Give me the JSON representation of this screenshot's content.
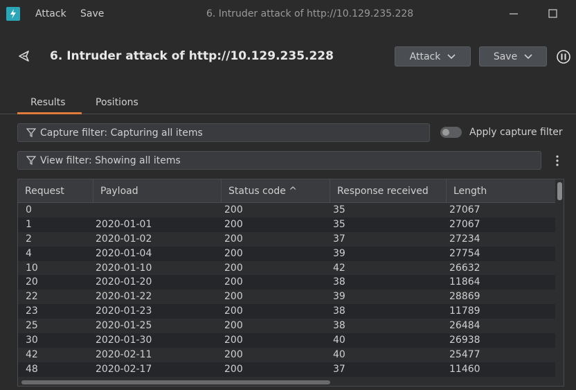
{
  "titlebar": {
    "menu": [
      "Attack",
      "Save"
    ],
    "window_title": "6. Intruder attack of http://10.129.235.228"
  },
  "header": {
    "title": "6. Intruder attack of http://10.129.235.228",
    "attack_label": "Attack",
    "save_label": "Save"
  },
  "tabs": [
    "Results",
    "Positions"
  ],
  "filters": {
    "capture": "Capture filter: Capturing all items",
    "view": "View filter: Showing all items",
    "apply_label": "Apply capture filter"
  },
  "table": {
    "columns": [
      "Request",
      "Payload",
      "Status code ^",
      "Response received",
      "Length"
    ],
    "rows": [
      [
        "0",
        "",
        "200",
        "35",
        "27067"
      ],
      [
        "1",
        "2020-01-01",
        "200",
        "35",
        "27067"
      ],
      [
        "2",
        "2020-01-02",
        "200",
        "37",
        "27234"
      ],
      [
        "4",
        "2020-01-04",
        "200",
        "39",
        "27754"
      ],
      [
        "10",
        "2020-01-10",
        "200",
        "42",
        "26632"
      ],
      [
        "20",
        "2020-01-20",
        "200",
        "38",
        "11864"
      ],
      [
        "22",
        "2020-01-22",
        "200",
        "39",
        "28869"
      ],
      [
        "23",
        "2020-01-23",
        "200",
        "38",
        "11789"
      ],
      [
        "25",
        "2020-01-25",
        "200",
        "38",
        "26484"
      ],
      [
        "30",
        "2020-01-30",
        "200",
        "40",
        "26938"
      ],
      [
        "42",
        "2020-02-11",
        "200",
        "40",
        "25477"
      ],
      [
        "48",
        "2020-02-17",
        "200",
        "37",
        "11460"
      ]
    ]
  },
  "colors": {
    "accent": "#e07b3e",
    "app_icon": "#29a6b8"
  }
}
